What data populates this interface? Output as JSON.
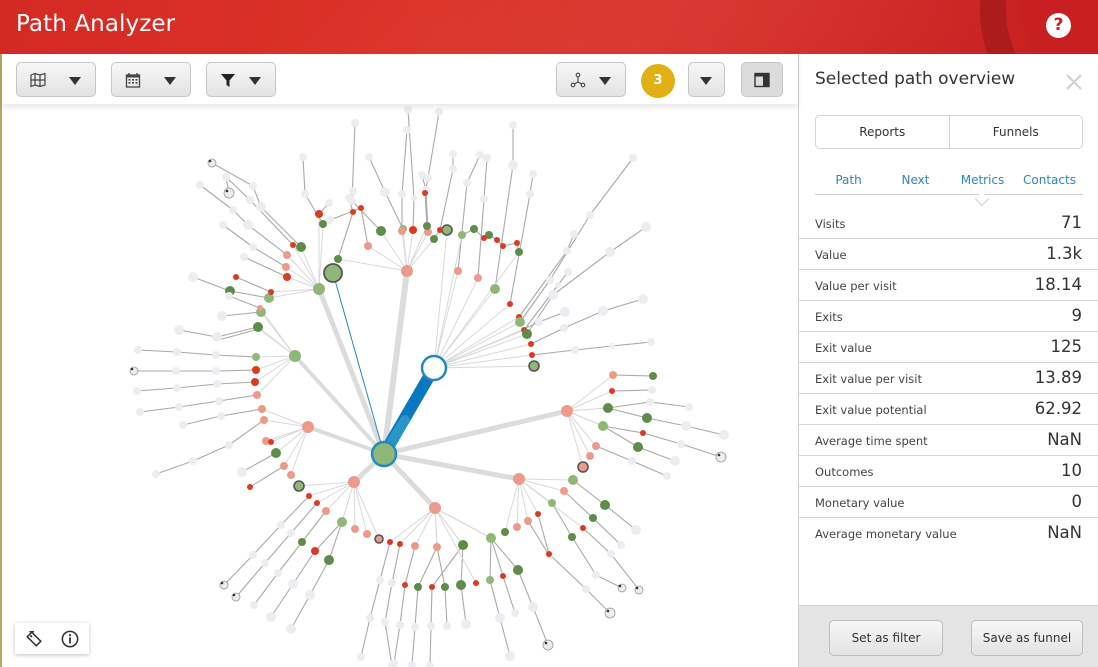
{
  "header": {
    "title": "Path Analyzer",
    "help_label": "?"
  },
  "toolbar": {
    "buttons": [
      {
        "icon": "map-icon"
      },
      {
        "icon": "calendar-icon"
      },
      {
        "icon": "filter-icon"
      },
      {
        "icon": "graph-layout-icon"
      }
    ],
    "badge_count": "3",
    "layout_icon": "panel-layout-icon"
  },
  "colors": {
    "accent": "#2589c0",
    "path_blue": "#0a77c0",
    "header_red": "#d42a24",
    "badge": "#e0b015",
    "node_light_green": "#8fb878",
    "node_dark_green": "#5e8c4a",
    "node_pink": "#ec9b8a",
    "node_red": "#dd3a22",
    "node_grey": "#ececf2"
  },
  "panel": {
    "title": "Selected path overview",
    "segments": [
      "Reports",
      "Funnels"
    ],
    "tabs": [
      "Path",
      "Next",
      "Metrics",
      "Contacts"
    ],
    "active_tab": "Metrics",
    "metrics": [
      {
        "label": "Visits",
        "value": "71"
      },
      {
        "label": "Value",
        "value": "1.3k"
      },
      {
        "label": "Value per visit",
        "value": "18.14"
      },
      {
        "label": "Exits",
        "value": "9"
      },
      {
        "label": "Exit value",
        "value": "125"
      },
      {
        "label": "Exit value per visit",
        "value": "13.89"
      },
      {
        "label": "Exit value potential",
        "value": "62.92"
      },
      {
        "label": "Average time spent",
        "value": "NaN"
      },
      {
        "label": "Outcomes",
        "value": "10"
      },
      {
        "label": "Monetary value",
        "value": "0"
      },
      {
        "label": "Average monetary value",
        "value": "NaN"
      }
    ],
    "footer": {
      "set_filter": "Set as filter",
      "save_funnel": "Save as funnel"
    }
  },
  "bottom_tools": [
    {
      "icon": "tags-icon"
    },
    {
      "icon": "info-icon"
    }
  ],
  "graph": {
    "root": {
      "kind": "light_green",
      "selected": true
    },
    "selected_path": [
      "root",
      "hub-ne"
    ],
    "hubs": [
      {
        "id": "hub-ne",
        "kind": "open",
        "angle": -62,
        "dist": 2.9
      },
      {
        "id": "hub-nw-big",
        "kind": "light_green_ring",
        "angle": -107,
        "dist": 4.1,
        "leaf": true
      },
      {
        "id": "hub-n",
        "kind": "pink",
        "angle": -79,
        "dist": 4.1
      },
      {
        "id": "hub-nw",
        "kind": "light_green",
        "angle": -120,
        "dist": 4.0
      },
      {
        "id": "hub-w",
        "kind": "light_green",
        "angle": -152,
        "dist": 2.4
      },
      {
        "id": "hub-w2",
        "kind": "pink",
        "angle": -171,
        "dist": 1.8
      },
      {
        "id": "hub-sw",
        "kind": "pink",
        "angle": 133,
        "dist": 1.1
      },
      {
        "id": "hub-s",
        "kind": "pink",
        "angle": 60,
        "dist": 1.5
      },
      {
        "id": "hub-se",
        "kind": "pink",
        "angle": 10,
        "dist": 3.1
      },
      {
        "id": "hub-e",
        "kind": "pink",
        "angle": -21,
        "dist": 4.2
      }
    ]
  }
}
